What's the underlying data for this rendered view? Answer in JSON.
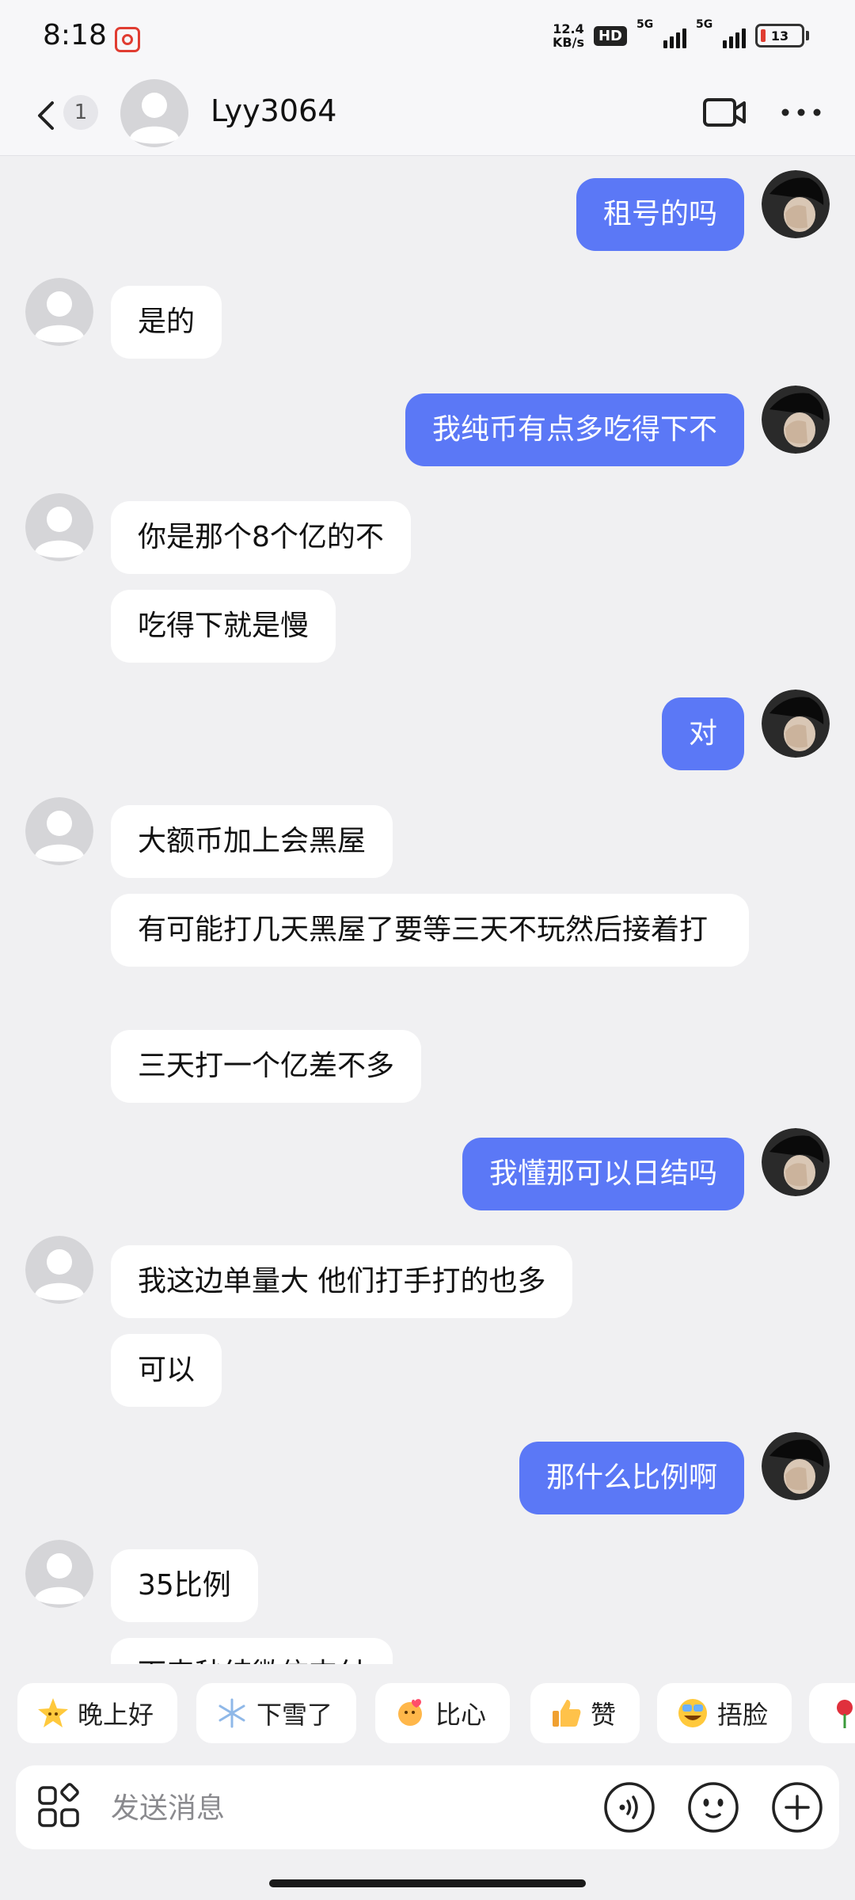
{
  "status_bar": {
    "time": "8:18",
    "net_speed_value": "12.4",
    "net_speed_unit": "KB/s",
    "hd_label": "HD",
    "signal_1_label": "5G",
    "signal_2_label": "5G",
    "battery_level": "13"
  },
  "header": {
    "unread_count": "1",
    "contact_name": "Lyy3064"
  },
  "messages": [
    {
      "from": "me",
      "text": "租号的吗"
    },
    {
      "from": "other",
      "text": "是的"
    },
    {
      "from": "me",
      "text": "我纯币有点多吃得下不"
    },
    {
      "from": "other",
      "text": "你是那个8个亿的不"
    },
    {
      "from": "other",
      "text": "吃得下就是慢"
    },
    {
      "from": "me",
      "text": "对"
    },
    {
      "from": "other",
      "text": "大额币加上会黑屋"
    },
    {
      "from": "other",
      "text": "有可能打几天黑屋了要等三天不玩然后接着打"
    },
    {
      "from": "other",
      "text": "三天打一个亿差不多"
    },
    {
      "from": "me",
      "text": "我懂那可以日结吗"
    },
    {
      "from": "other",
      "text": "我这边单量大 他们打手打的也多"
    },
    {
      "from": "other",
      "text": "可以"
    },
    {
      "from": "me",
      "text": "那什么比例啊"
    },
    {
      "from": "other",
      "text": "35比例"
    },
    {
      "from": "other",
      "text": "下来秒结微信支付"
    }
  ],
  "quick_replies": [
    {
      "label": "晚上好",
      "icon": "star-face-emoji"
    },
    {
      "label": "下雪了",
      "icon": "snowflake-emoji"
    },
    {
      "label": "比心",
      "icon": "heart-hands-emoji"
    },
    {
      "label": "赞",
      "icon": "thumbs-up-emoji"
    },
    {
      "label": "捂脸",
      "icon": "facepalm-emoji"
    },
    {
      "label": "",
      "icon": "rose-emoji"
    }
  ],
  "input": {
    "placeholder": "发送消息"
  },
  "colors": {
    "my_bubble": "#5b78f6",
    "their_bubble": "#ffffff",
    "background": "#f0f0f2",
    "battery_low": "#e03c31"
  }
}
